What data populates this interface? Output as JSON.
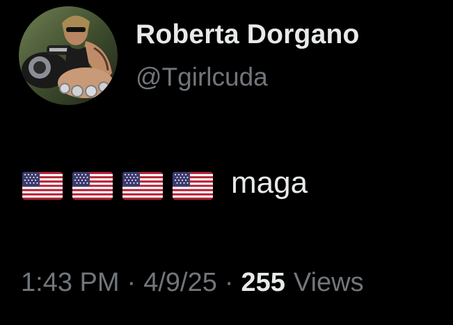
{
  "profile": {
    "display_name": "Roberta Dorgano",
    "handle": "@Tgirlcuda",
    "avatar_icon": "profile-photo-avatar"
  },
  "tweet": {
    "flags": [
      "🇺🇸",
      "🇺🇸",
      "🇺🇸",
      "🇺🇸"
    ],
    "flag_icon": "us-flag-emoji",
    "text": "maga"
  },
  "meta": {
    "time": "1:43 PM",
    "separator": "·",
    "date": "4/9/25",
    "views_count": "255",
    "views_label": "Views"
  },
  "colors": {
    "background": "#000000",
    "primary_text": "#e7e9ea",
    "secondary_text": "#71767b"
  }
}
